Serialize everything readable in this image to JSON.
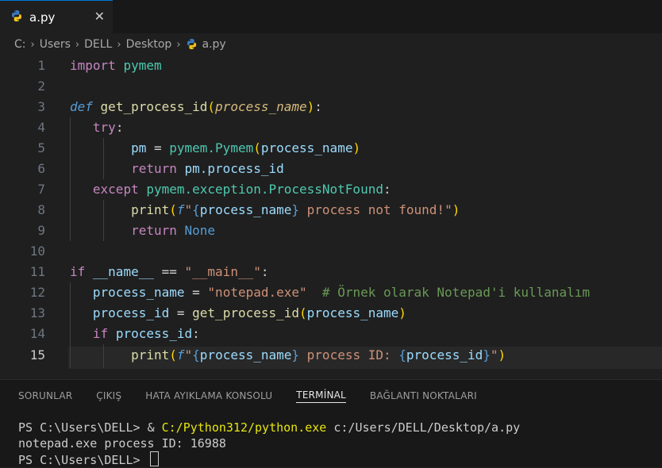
{
  "tab": {
    "label": "a.py",
    "close": "✕"
  },
  "breadcrumb": {
    "parts": [
      "C:",
      "Users",
      "DELL",
      "Desktop",
      "a.py"
    ],
    "separator": "›"
  },
  "editor": {
    "line_numbers": [
      "1",
      "2",
      "3",
      "4",
      "5",
      "6",
      "7",
      "8",
      "9",
      "10",
      "11",
      "12",
      "13",
      "14",
      "15"
    ],
    "current_line": "15",
    "code": {
      "import_kw": "import",
      "pymem": "pymem",
      "def_kw": "def",
      "get_process_id": "get_process_id",
      "paren_open": "(",
      "paren_close": ")",
      "colon": ":",
      "process_name": "process_name",
      "try_kw": "try",
      "pm": "pm",
      "assign": "=",
      "pymem_dot": "pymem.",
      "Pymem": "Pymem",
      "return_kw": "return",
      "pm_process_id": "pm.process_id",
      "except_kw": "except",
      "exception_path": "pymem.exception.ProcessNotFound",
      "print_fn": "print",
      "f_prefix": "f",
      "dquote": "\"",
      "brace_open": "{",
      "brace_close": "}",
      "str_not_found": " process not found!",
      "None": "None",
      "if_kw": "if",
      "dunder_name": "__name__",
      "eq": "==",
      "str_main": "\"__main__\"",
      "str_notepad": "\"notepad.exe\"",
      "comment": "# Örnek olarak Notepad'i kullanalım",
      "process_id": "process_id",
      "str_pid": " process ID: "
    }
  },
  "panel": {
    "tabs": [
      "SORUNLAR",
      "ÇIKIŞ",
      "HATA AYIKLAMA KONSOLU",
      "TERMİNAL",
      "BAĞLANTI NOKTALARI"
    ],
    "active_tab": "TERMİNAL",
    "terminal": {
      "prompt": "PS C:\\Users\\DELL> ",
      "amp": "& ",
      "python_path": "C:/Python312/python.exe",
      "script_path": " c:/Users/DELL/Desktop/a.py",
      "output": "notepad.exe process ID: 16988",
      "prompt2": "PS C:\\Users\\DELL> "
    }
  },
  "colors": {
    "accent": "#0078d4",
    "editor_bg": "#1f1f1f",
    "panel_bg": "#181818"
  }
}
